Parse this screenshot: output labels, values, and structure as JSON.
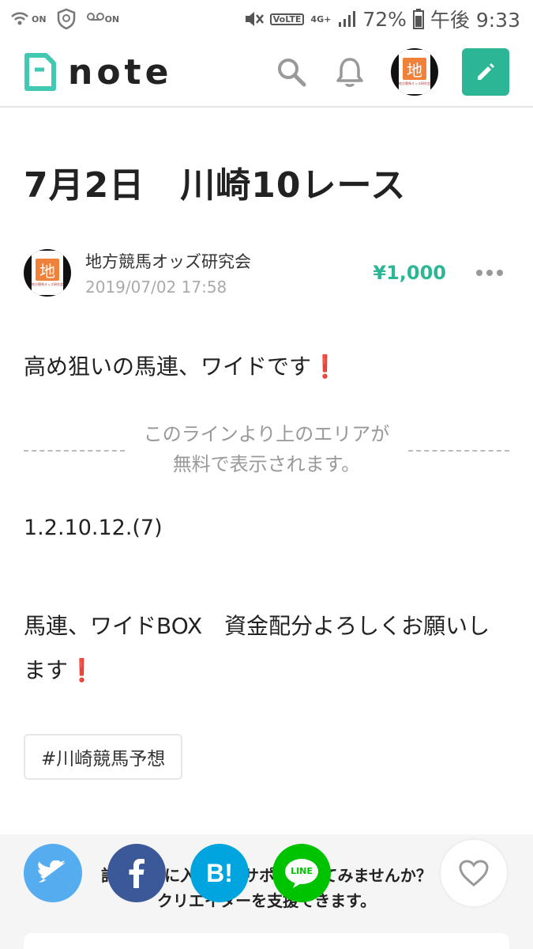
{
  "status_bar": {
    "battery": "72%",
    "time": "午後 9:33",
    "network": "4G+",
    "volte": "VoLTE",
    "on_label_1": "ON",
    "on_label_2": "ON"
  },
  "header": {
    "logo_text": "note",
    "icons": [
      "search-icon",
      "bell-icon",
      "avatar",
      "pencil-icon"
    ],
    "accent_color": "#2cb696"
  },
  "article": {
    "title": "7月2日　川崎10レース",
    "author_name": "地方競馬オッズ研究会",
    "date": "2019/07/02 17:58",
    "price": "¥1,000",
    "avatar_char": "地",
    "avatar_caption": "地方競馬オッズ研究会",
    "paragraph_1": "高め狙いの馬連、ワイドです",
    "mark": "❗",
    "divider_line_1": "このラインより上のエリアが",
    "divider_line_2": "無料で表示されます。",
    "paragraph_2": "1.2.10.12.(7)",
    "paragraph_3": "馬連、ワイドBOX　資金配分よろしくお願いします",
    "tag": "#川崎競馬予想"
  },
  "support": {
    "line_1": "記事が気に入ったらサポートしてみませんか？",
    "line_2": "クリエイターを支援できます。",
    "share_buttons": [
      "twitter",
      "facebook",
      "hatena",
      "line"
    ],
    "hatena_label": "B!",
    "line_label": "LINE"
  }
}
